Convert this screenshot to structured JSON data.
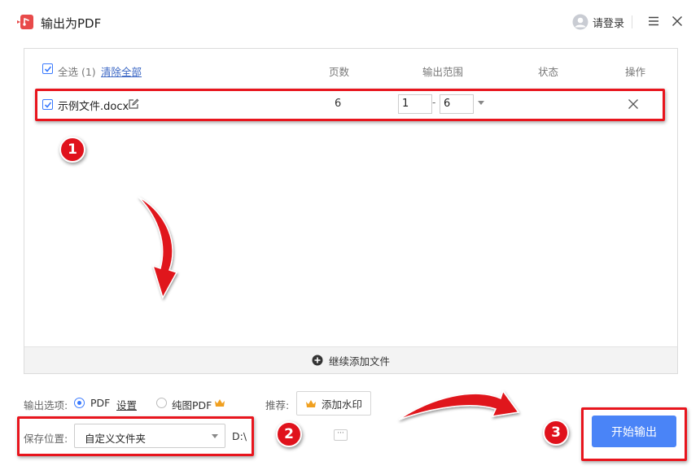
{
  "window": {
    "title": "输出为PDF",
    "login_label": "请登录"
  },
  "list": {
    "select_all_label": "全选 (1)",
    "clear_all_label": "清除全部",
    "columns": {
      "pages": "页数",
      "range": "输出范围",
      "status": "状态",
      "actions": "操作"
    },
    "files": [
      {
        "name": "示例文件.docx",
        "pages": "6",
        "range_from": "1",
        "range_to": "6",
        "checked": true
      }
    ],
    "add_more_label": "继续添加文件"
  },
  "options": {
    "output_label": "输出选项:",
    "pdf_label": "PDF",
    "settings_label": "设置",
    "image_pdf_label": "纯图PDF",
    "recommend_label": "推荐:",
    "watermark_label": "添加水印",
    "save_label": "保存位置:",
    "save_option": "自定义文件夹",
    "save_path": "D:\\",
    "browse_label": "···",
    "start_label": "开始输出"
  },
  "annotations": {
    "step1": "1",
    "step2": "2",
    "step3": "3"
  },
  "colors": {
    "accent": "#4a84f7",
    "annotation_red": "#e8151d",
    "crown": "#f0a020"
  }
}
